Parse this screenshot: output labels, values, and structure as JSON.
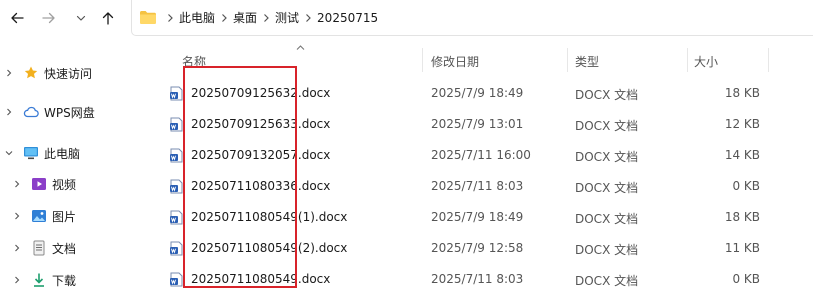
{
  "address_bar": {
    "crumbs": [
      "此电脑",
      "桌面",
      "测试",
      "20250715"
    ]
  },
  "sidebar": {
    "items": [
      {
        "label": "快速访问",
        "icon": "star-icon",
        "expanded": false
      },
      {
        "label": "WPS网盘",
        "icon": "cloud-icon",
        "expanded": false
      },
      {
        "label": "此电脑",
        "icon": "computer-icon",
        "expanded": true
      },
      {
        "label": "视频",
        "icon": "video-icon",
        "expanded": false
      },
      {
        "label": "图片",
        "icon": "picture-icon",
        "expanded": false
      },
      {
        "label": "文档",
        "icon": "document-icon",
        "expanded": false
      },
      {
        "label": "下载",
        "icon": "download-icon",
        "expanded": false
      }
    ]
  },
  "columns": {
    "name": "名称",
    "date": "修改日期",
    "type": "类型",
    "size": "大小"
  },
  "files": [
    {
      "name": "20250709125632.docx",
      "date": "2025/7/9 18:49",
      "type": "DOCX 文档",
      "size": "18 KB"
    },
    {
      "name": "20250709125633.docx",
      "date": "2025/7/9 13:01",
      "type": "DOCX 文档",
      "size": "12 KB"
    },
    {
      "name": "20250709132057.docx",
      "date": "2025/7/11 16:00",
      "type": "DOCX 文档",
      "size": "14 KB"
    },
    {
      "name": "20250711080336.docx",
      "date": "2025/7/11 8:03",
      "type": "DOCX 文档",
      "size": "0 KB"
    },
    {
      "name": "20250711080549(1).docx",
      "date": "2025/7/9 18:49",
      "type": "DOCX 文档",
      "size": "18 KB"
    },
    {
      "name": "20250711080549(2).docx",
      "date": "2025/7/9 12:58",
      "type": "DOCX 文档",
      "size": "11 KB"
    },
    {
      "name": "20250711080549.docx",
      "date": "2025/7/11 8:03",
      "type": "DOCX 文档",
      "size": "0 KB"
    }
  ],
  "colors": {
    "highlight_box": "#d8232a",
    "folder_yellow": "#f5c242",
    "word_blue": "#2b5fb4"
  }
}
